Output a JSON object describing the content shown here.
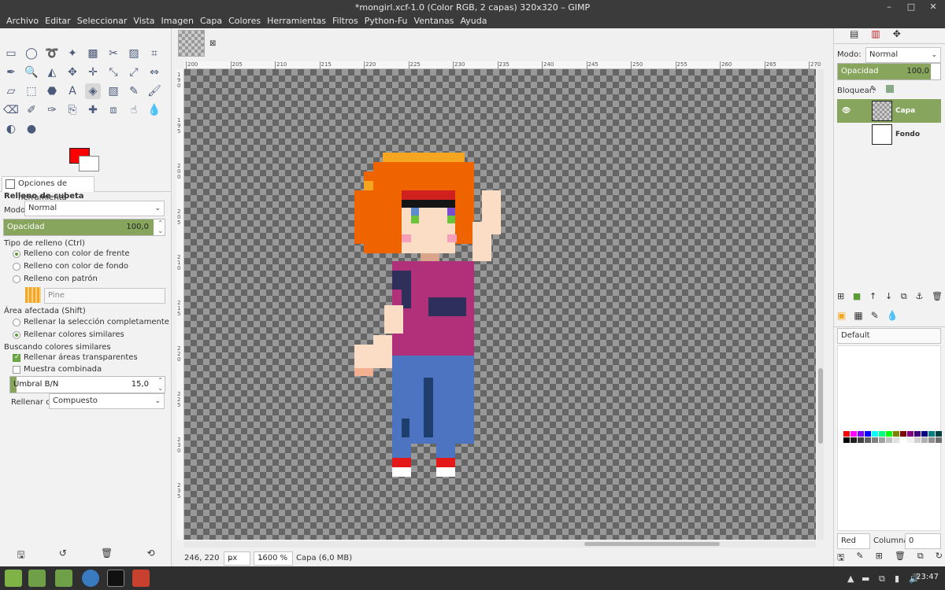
{
  "window": {
    "title": "*mongirl.xcf-1.0 (Color RGB, 2 capas) 320x320 – GIMP"
  },
  "menu": [
    "Archivo",
    "Editar",
    "Seleccionar",
    "Vista",
    "Imagen",
    "Capa",
    "Colores",
    "Herramientas",
    "Filtros",
    "Python-Fu",
    "Ventanas",
    "Ayuda"
  ],
  "colors": {
    "accent": "#88a55e",
    "foreground": "#ff0000",
    "background": "#ffffff",
    "chrome": "#3b3b3b"
  },
  "tool_options": {
    "tab_label": "Opciones de herramienta",
    "tool_name": "Relleno de cubeta",
    "mode_label": "Modo:",
    "mode_value": "Normal",
    "opacity_label": "Opacidad",
    "opacity_value": "100,0",
    "fill_type_label": "Tipo de relleno  (Ctrl)",
    "fill_fg": "Relleno con color de frente",
    "fill_bg": "Relleno con color de fondo",
    "fill_pattern": "Relleno con patrón",
    "pattern_name": "Pine",
    "area_label": "Área afectada  (Shift)",
    "area_whole": "Rellenar la selección completamente",
    "area_similar": "Rellenar colores similares",
    "find_label": "Buscando colores similares",
    "fill_transparent": "Rellenar áreas transparentes",
    "sample_merged": "Muestra combinada",
    "threshold_label": "Umbral B/N",
    "threshold_value": "15,0",
    "fill_by_label": "Rellenar con:",
    "fill_by_value": "Compuesto"
  },
  "ruler": {
    "h_ticks": [
      "200",
      "205",
      "210",
      "215",
      "220",
      "225",
      "230",
      "235",
      "240",
      "245",
      "250",
      "255",
      "260",
      "265",
      "270"
    ],
    "v_ticks": [
      "190",
      "195",
      "200",
      "205",
      "210",
      "215",
      "220",
      "225",
      "230",
      "235"
    ]
  },
  "status": {
    "coords": "246, 220",
    "unit": "px",
    "zoom": "1600 %",
    "layer_info": "Capa (6,0 MB)"
  },
  "layers_panel": {
    "mode_label": "Modo:",
    "mode_value": "Normal",
    "opacity_label": "Opacidad",
    "opacity_value": "100,0",
    "lock_label": "Bloquear:",
    "layers": [
      {
        "name": "Capa",
        "selected": true
      },
      {
        "name": "Fondo",
        "selected": false
      }
    ]
  },
  "brushes_panel": {
    "preset": "Default"
  },
  "palette_panel": {
    "name": "Red",
    "columns_label": "Columnas:",
    "columns_value": "0"
  },
  "taskbar": {
    "clock": "23:47"
  }
}
